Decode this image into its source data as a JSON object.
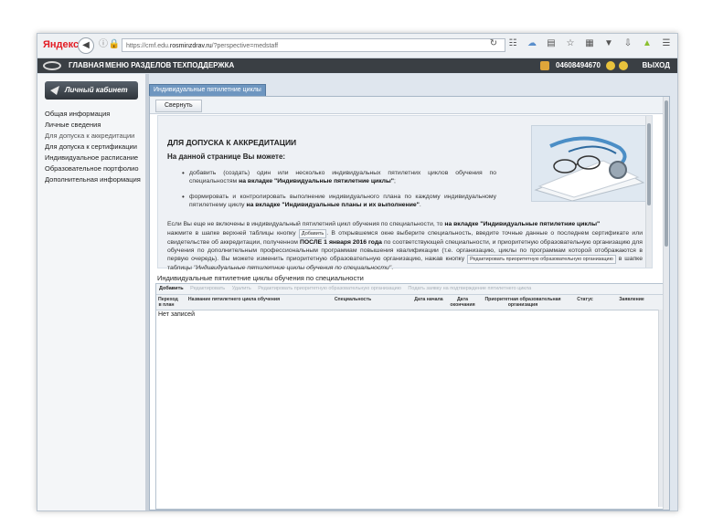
{
  "browser": {
    "brand": "Яндекс",
    "url_prefix": "https://cmf.edu.",
    "url_domain": "rosminzdrav.ru",
    "url_suffix": "/?perspective=medstaff",
    "icons": [
      "reload-icon",
      "translate-icon",
      "cloud-icon",
      "tabs-icon",
      "star-icon",
      "reader-icon",
      "pocket-icon",
      "download-icon",
      "bird-icon",
      "menu-icon"
    ]
  },
  "header": {
    "nav": [
      "ГЛАВНАЯ",
      "МЕНЮ РАЗДЕЛОВ",
      "ТЕХПОДДЕРЖКА"
    ],
    "user_id": "04608494670",
    "exit": "ВЫХОД"
  },
  "sidebar": {
    "title": "Личный кабинет",
    "items": [
      "Общая информация",
      "Личные сведения",
      "Для допуска к аккредитации",
      "Для допуска к сертификации",
      "Индивидуальное расписание",
      "Образовательное портфолио",
      "Дополнительная информация"
    ]
  },
  "main": {
    "tab": "Индивидуальные пятилетние циклы",
    "collapse_button": "Свернуть",
    "info": {
      "heading": "ДЛЯ ДОПУСКА К АККРЕДИТАЦИИ",
      "subheading": "На данной странице Вы можете:",
      "bullet1_a": "добавить (создать) один или несколько индивидуальных пятилетних циклов обучения по специальностям",
      "bullet1_b": "на вкладке \"Индивидуальные пятилетние циклы\"",
      "bullet1_c": ";",
      "bullet2_a": "формировать и контролировать выполнение индивидуального плана по каждому индивидуальному пятилетнему циклу",
      "bullet2_b": "на вкладке \"Индивидуальные планы и их выполнение\"",
      "bullet2_c": ".",
      "para1_a": "Если Вы еще не включены в индивидуальный пятилетний цикл обучения по специальности, то",
      "para1_b": "на вкладке \"Индивидуальные пятилетние циклы\"",
      "para2_a": "нажмите в шапке верхней таблицы кнопку",
      "add_inline": "Добавить",
      "para2_b": ". В открывшемся окне выберите специальность, введите точные данные о последнем сертификате или свидетельстве об аккредитации, полученном",
      "para2_c": "ПОСЛЕ 1 января 2016 года",
      "para2_d": "по соответствующей специальности, и приоритетную образовательную организацию для обучения по дополнительным профессиональным программам повышения квалификации (т.е. организацию, циклы по программам которой отображаются в первую очередь). Вы можете изменить приоритетную образовательную организацию, нажав кнопку",
      "edit_inline": "Редактировать приоритетную образовательную организацию",
      "para3_a": "в шапке таблицы",
      "para3_b": "\"Индивидуальные пятилетние циклы обучения по специальности\"",
      "para3_c": "."
    },
    "grid": {
      "title": "Индивидуальные пятилетние циклы обучения по специальности",
      "toolbar": [
        "Добавить",
        "Редактировать",
        "Удалить",
        "Редактировать приоритетную образовательную организацию",
        "Подать заявку на подтверждение пятилетнего цикла"
      ],
      "columns": [
        "Переход в план",
        "Название пятилетнего цикла обучения",
        "Специальность",
        "Дата начала",
        "Дата окончания",
        "Приоритетная образовательная организация",
        "Статус",
        "Заявление"
      ],
      "empty": "Нет записей"
    }
  }
}
